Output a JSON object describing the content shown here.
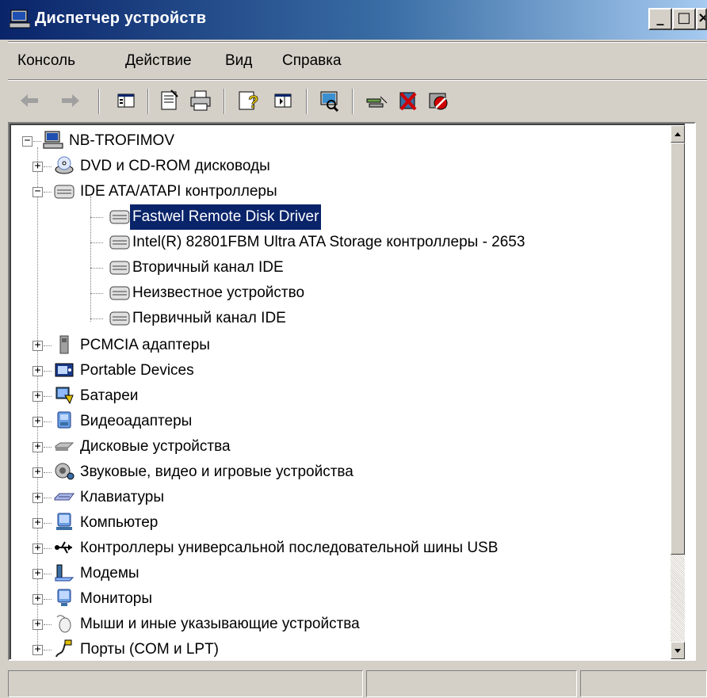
{
  "window": {
    "title": "Диспетчер устройств",
    "controls": {
      "minimize": "_",
      "maximize": "□",
      "close": "×"
    }
  },
  "menu": [
    "Консоль",
    "Действие",
    "Вид",
    "Справка"
  ],
  "toolbar": {
    "icons": [
      "back-arrow-icon",
      "forward-arrow-icon",
      "show-hide-tree-icon",
      "properties-icon",
      "print-icon",
      "help-icon",
      "view-icon",
      "scan-hardware-icon",
      "update-driver-icon",
      "uninstall-icon",
      "disable-icon"
    ]
  },
  "tree": {
    "root": "NB-TROFIMOV",
    "categories": [
      {
        "label": "DVD и CD-ROM дисководы",
        "icon": "cdrom-icon",
        "expanded": false
      },
      {
        "label": "IDE ATA/ATAPI контроллеры",
        "icon": "ide-controller-icon",
        "expanded": true,
        "children": [
          {
            "label": "Fastwel Remote Disk Driver",
            "selected": true
          },
          {
            "label": "Intel(R) 82801FBM Ultra ATA Storage контроллеры - 2653"
          },
          {
            "label": "Вторичный канал IDE"
          },
          {
            "label": "Неизвестное устройство"
          },
          {
            "label": "Первичный канал IDE"
          }
        ]
      },
      {
        "label": "PCMCIA адаптеры",
        "icon": "pcmcia-icon",
        "expanded": false
      },
      {
        "label": "Portable Devices",
        "icon": "portable-device-icon",
        "expanded": false
      },
      {
        "label": "Батареи",
        "icon": "battery-icon",
        "expanded": false
      },
      {
        "label": "Видеоадаптеры",
        "icon": "display-adapter-icon",
        "expanded": false
      },
      {
        "label": "Дисковые устройства",
        "icon": "disk-drive-icon",
        "expanded": false
      },
      {
        "label": "Звуковые, видео и игровые устройства",
        "icon": "sound-icon",
        "expanded": false
      },
      {
        "label": "Клавиатуры",
        "icon": "keyboard-icon",
        "expanded": false
      },
      {
        "label": "Компьютер",
        "icon": "computer-icon",
        "expanded": false
      },
      {
        "label": "Контроллеры универсальной последовательной шины USB",
        "icon": "usb-icon",
        "expanded": false
      },
      {
        "label": "Модемы",
        "icon": "modem-icon",
        "expanded": false
      },
      {
        "label": "Мониторы",
        "icon": "monitor-icon",
        "expanded": false
      },
      {
        "label": "Мыши и иные указывающие устройства",
        "icon": "mouse-icon",
        "expanded": false
      },
      {
        "label": "Порты (COM и LPT)",
        "icon": "port-icon",
        "expanded": false
      }
    ]
  },
  "status": [
    "",
    "",
    ""
  ],
  "colors": {
    "title_gradient_start": "#0a246a",
    "title_gradient_end": "#a6caf0",
    "selection": "#0a246a",
    "face": "#d4d0c8"
  }
}
